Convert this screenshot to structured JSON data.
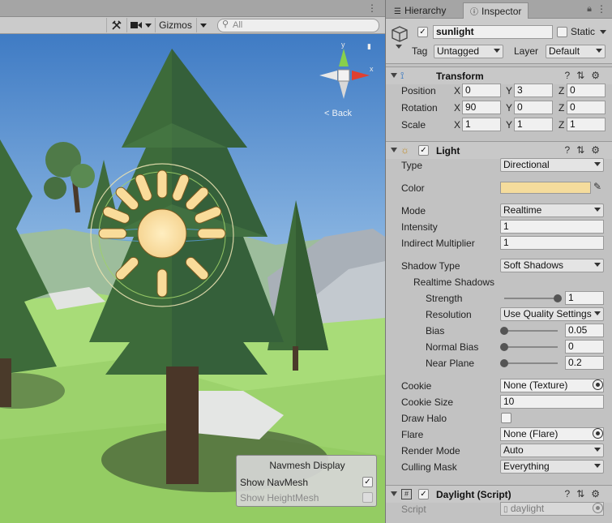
{
  "scene": {
    "toolbar": {
      "tools_icon": "tools-icon",
      "camera_icon": "camera-icon",
      "gizmos_label": "Gizmos",
      "search_placeholder": "All"
    },
    "back_label": "Back",
    "navmesh_panel": {
      "title": "Navmesh Display",
      "show_navmesh": "Show NavMesh",
      "show_navmesh_checked": true,
      "show_heightmesh": "Show HeightMesh",
      "show_heightmesh_checked": false
    }
  },
  "inspector": {
    "tabs": {
      "hierarchy": "Hierarchy",
      "inspector": "Inspector"
    },
    "object": {
      "name": "sunlight",
      "active": true,
      "static_label": "Static",
      "tag_label": "Tag",
      "tag_value": "Untagged",
      "layer_label": "Layer",
      "layer_value": "Default"
    },
    "transform": {
      "title": "Transform",
      "position": {
        "label": "Position",
        "x": "0",
        "y": "3",
        "z": "0"
      },
      "rotation": {
        "label": "Rotation",
        "x": "90",
        "y": "0",
        "z": "0"
      },
      "scale": {
        "label": "Scale",
        "x": "1",
        "y": "1",
        "z": "1"
      }
    },
    "light": {
      "title": "Light",
      "enabled": true,
      "type": {
        "label": "Type",
        "value": "Directional"
      },
      "color": {
        "label": "Color",
        "value": "#f5dc9c"
      },
      "mode": {
        "label": "Mode",
        "value": "Realtime"
      },
      "intensity": {
        "label": "Intensity",
        "value": "1"
      },
      "indirect_multiplier": {
        "label": "Indirect Multiplier",
        "value": "1"
      },
      "shadow_type": {
        "label": "Shadow Type",
        "value": "Soft Shadows"
      },
      "realtime_shadows_label": "Realtime Shadows",
      "strength": {
        "label": "Strength",
        "value": "1",
        "fraction": 1.0
      },
      "resolution": {
        "label": "Resolution",
        "value": "Use Quality Settings"
      },
      "bias": {
        "label": "Bias",
        "value": "0.05",
        "fraction": 0.0
      },
      "normal_bias": {
        "label": "Normal Bias",
        "value": "0",
        "fraction": 0.0
      },
      "near_plane": {
        "label": "Near Plane",
        "value": "0.2",
        "fraction": 0.0
      },
      "cookie": {
        "label": "Cookie",
        "value": "None (Texture)"
      },
      "cookie_size": {
        "label": "Cookie Size",
        "value": "10"
      },
      "draw_halo": {
        "label": "Draw Halo",
        "checked": false
      },
      "flare": {
        "label": "Flare",
        "value": "None (Flare)"
      },
      "render_mode": {
        "label": "Render Mode",
        "value": "Auto"
      },
      "culling_mask": {
        "label": "Culling Mask",
        "value": "Everything"
      }
    },
    "daylight": {
      "title": "Daylight (Script)",
      "enabled": true,
      "script_label": "Script",
      "script_value": "daylight"
    }
  },
  "colors": {
    "sky_top": "#3f7bc4",
    "grass": "#a8dc78",
    "tree_dark": "#3d6b3a",
    "light_color": "#f5dc9c"
  }
}
